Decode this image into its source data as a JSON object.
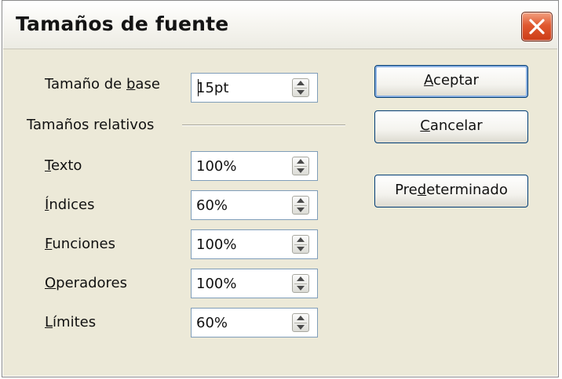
{
  "window": {
    "title": "Tamaños de fuente",
    "close_icon": "close-x-icon",
    "close_color": "#e0582f"
  },
  "base_size": {
    "label": {
      "pre": "Tamaño de ",
      "mnemonic": "b",
      "post": "ase"
    },
    "value": "15pt"
  },
  "relative": {
    "group_label": "Tamaños relativos",
    "items": [
      {
        "label": {
          "pre": "",
          "mnemonic": "T",
          "post": "exto"
        },
        "value": "100%"
      },
      {
        "label": {
          "pre": "",
          "mnemonic": "Í",
          "post": "ndices"
        },
        "value": "60%"
      },
      {
        "label": {
          "pre": "",
          "mnemonic": "F",
          "post": "unciones"
        },
        "value": "100%"
      },
      {
        "label": {
          "pre": "",
          "mnemonic": "O",
          "post": "peradores"
        },
        "value": "100%"
      },
      {
        "label": {
          "pre": "",
          "mnemonic": "L",
          "post": "ímites"
        },
        "value": "60%"
      }
    ]
  },
  "buttons": {
    "accept": {
      "pre": "",
      "mnemonic": "A",
      "post": "ceptar"
    },
    "cancel": {
      "pre": "",
      "mnemonic": "C",
      "post": "ancelar"
    },
    "default": {
      "pre": "Pre",
      "mnemonic": "d",
      "post": "eterminado"
    }
  },
  "colors": {
    "dialog_bg": "#ece9d8",
    "input_border": "#7f9db9",
    "button_border": "#003c74"
  }
}
